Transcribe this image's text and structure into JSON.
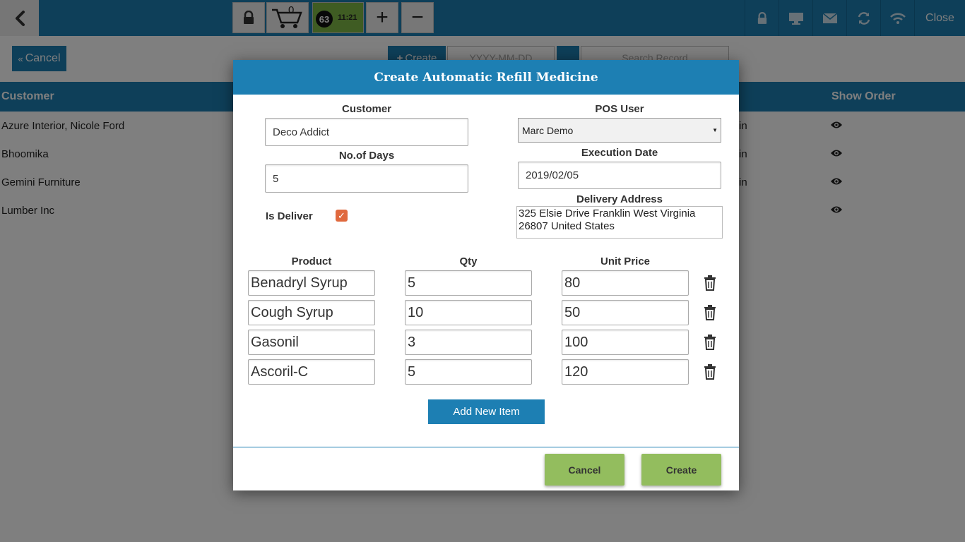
{
  "topbar": {
    "cart_count": "0",
    "badge_number": "63",
    "time": "11:21",
    "plus": "+",
    "minus": "−",
    "close_label": "Close"
  },
  "page": {
    "cancel_label": "Cancel",
    "create_label": "Create",
    "date_placeholder": "YYYY-MM-DD",
    "search_placeholder": "Search Record",
    "columns": {
      "customer": "Customer",
      "show_order": "Show Order"
    },
    "rows": [
      {
        "customer": "Azure Interior, Nicole Ford",
        "cut": "in"
      },
      {
        "customer": "Bhoomika",
        "cut": "in"
      },
      {
        "customer": "Gemini Furniture",
        "cut": "in"
      },
      {
        "customer": "Lumber Inc",
        "cut": ""
      }
    ]
  },
  "modal": {
    "title": "Create Automatic Refill Medicine",
    "customer_label": "Customer",
    "customer_value": "Deco Addict",
    "days_label": "No.of Days",
    "days_value": "5",
    "pos_user_label": "POS User",
    "pos_user_value": "Marc Demo",
    "exec_date_label": "Execution Date",
    "exec_date_value": "2019/02/05",
    "is_deliver_label": "Is Deliver",
    "is_deliver_checked": true,
    "address_label": "Delivery Address",
    "address_value": "325 Elsie Drive Franklin West Virginia 26807 United States",
    "product_header": "Product",
    "qty_header": "Qty",
    "price_header": "Unit Price",
    "items": [
      {
        "product": "Benadryl Syrup",
        "qty": "5",
        "price": "80"
      },
      {
        "product": "Cough Syrup",
        "qty": "10",
        "price": "50"
      },
      {
        "product": "Gasonil",
        "qty": "3",
        "price": "100"
      },
      {
        "product": "Ascoril-C",
        "qty": "5",
        "price": "120"
      }
    ],
    "add_item_label": "Add New Item",
    "cancel_label": "Cancel",
    "create_label": "Create"
  },
  "colors": {
    "primary": "#1d7fb3",
    "button_green": "#93bd5e",
    "checkbox": "#e0693e"
  }
}
